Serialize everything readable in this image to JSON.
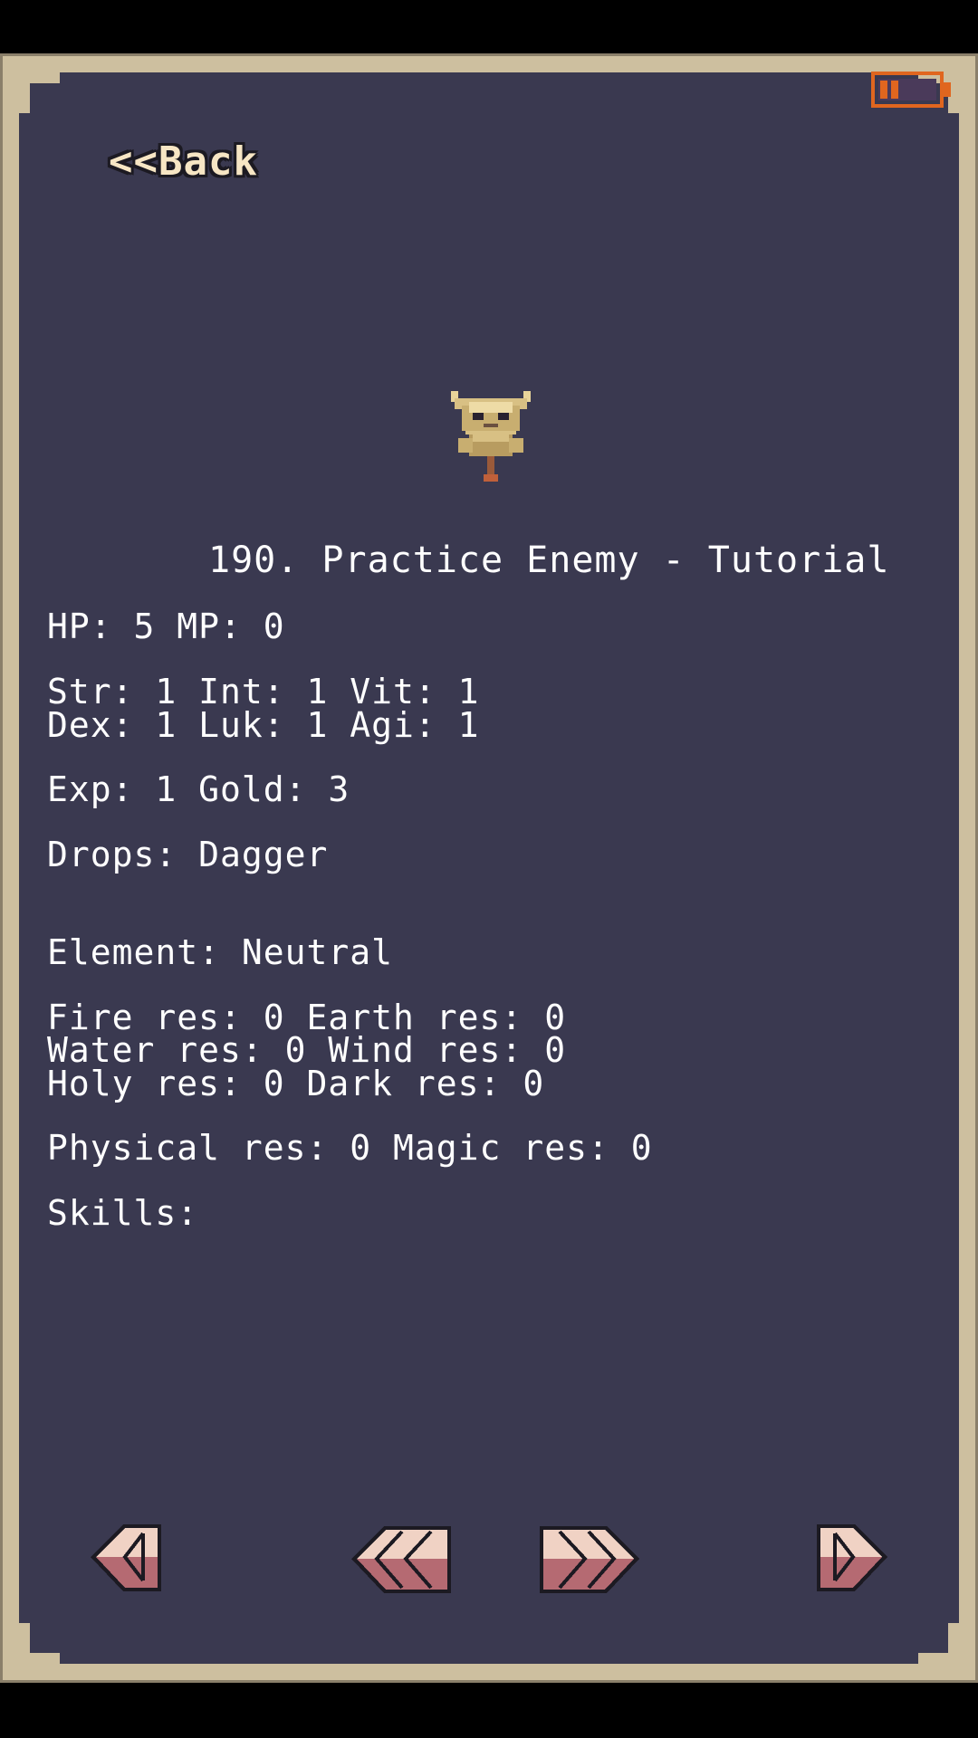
{
  "header": {
    "back_label": "<<Back"
  },
  "enemy": {
    "title": "190. Practice Enemy - Tutorial",
    "hp_mp": "HP: 5 MP: 0",
    "stats_line1": "Str: 1 Int: 1 Vit: 1",
    "stats_line2": "Dex: 1 Luk: 1 Agi: 1",
    "exp_gold": "Exp: 1 Gold: 3",
    "drops": "Drops: Dagger",
    "element": "Element: Neutral",
    "res_line1": "Fire res: 0 Earth res: 0",
    "res_line2": "Water res: 0 Wind res: 0",
    "res_line3": "Holy res: 0 Dark res: 0",
    "phys_magic": "Physical res: 0 Magic res: 0",
    "skills": "Skills:"
  },
  "icons": {
    "battery": "battery-icon",
    "enemy": "horned-enemy-sprite",
    "prev": "arrow-left-icon",
    "prev_fast": "double-arrow-left-icon",
    "next_fast": "double-arrow-right-icon",
    "next": "arrow-right-icon"
  },
  "colors": {
    "background": "#000000",
    "frame": "#cdbf9f",
    "panel": "#3a3950",
    "text": "#ffffff",
    "back_text": "#f7e6c4",
    "battery": "#e0661f",
    "nav_light": "#f0d2c4",
    "nav_dark": "#b56a72"
  }
}
